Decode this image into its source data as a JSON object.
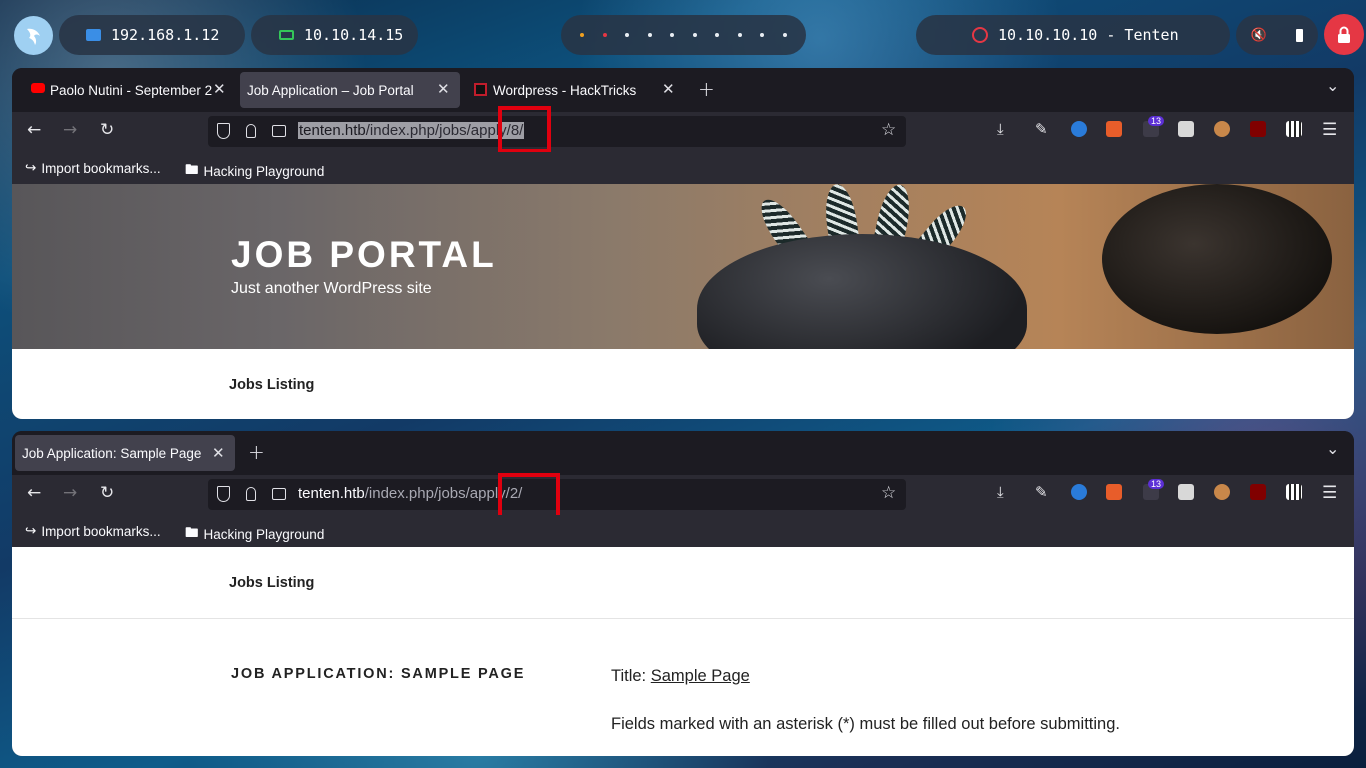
{
  "taskbar": {
    "ip_local": "192.168.1.12",
    "ip_vpn": "10.10.14.15",
    "target": "10.10.10.10 - Tenten",
    "colors": {
      "local_icon": "#3a8ee6",
      "vpn_icon": "#34c759",
      "target_icon": "#e53744",
      "lock": "#e53744"
    }
  },
  "window1": {
    "tabs": [
      {
        "label": "Paolo Nutini - September 2",
        "icon": "youtube-icon"
      },
      {
        "label": "Job Application – Job Portal",
        "icon": ""
      },
      {
        "label": "Wordpress - HackTricks",
        "icon": "hacktricks-icon"
      }
    ],
    "url_host": "tenten.htb",
    "url_path": "/index.php/jobs/apply/8/",
    "extension_badge": "13",
    "bookmarks": [
      {
        "label": "Import bookmarks...",
        "icon": "import-icon"
      },
      {
        "label": "Hacking Playground",
        "icon": "folder-icon"
      }
    ],
    "site_title": "JOB PORTAL",
    "site_tagline": "Just another WordPress site",
    "nav_link": "Jobs Listing"
  },
  "window2": {
    "tabs": [
      {
        "label": "Job Application: Sample Page",
        "icon": ""
      }
    ],
    "url_host": "tenten.htb",
    "url_path": "/index.php/jobs/apply/2/",
    "extension_badge": "13",
    "bookmarks": [
      {
        "label": "Import bookmarks...",
        "icon": "import-icon"
      },
      {
        "label": "Hacking Playground",
        "icon": "folder-icon"
      }
    ],
    "nav_link": "Jobs Listing",
    "entry_title": "JOB APPLICATION: SAMPLE PAGE",
    "title_label": "Title:",
    "title_link": "Sample Page",
    "fields_note": "Fields marked with an asterisk (*) must be filled out before submitting."
  },
  "highlight_color": "#e0000f"
}
